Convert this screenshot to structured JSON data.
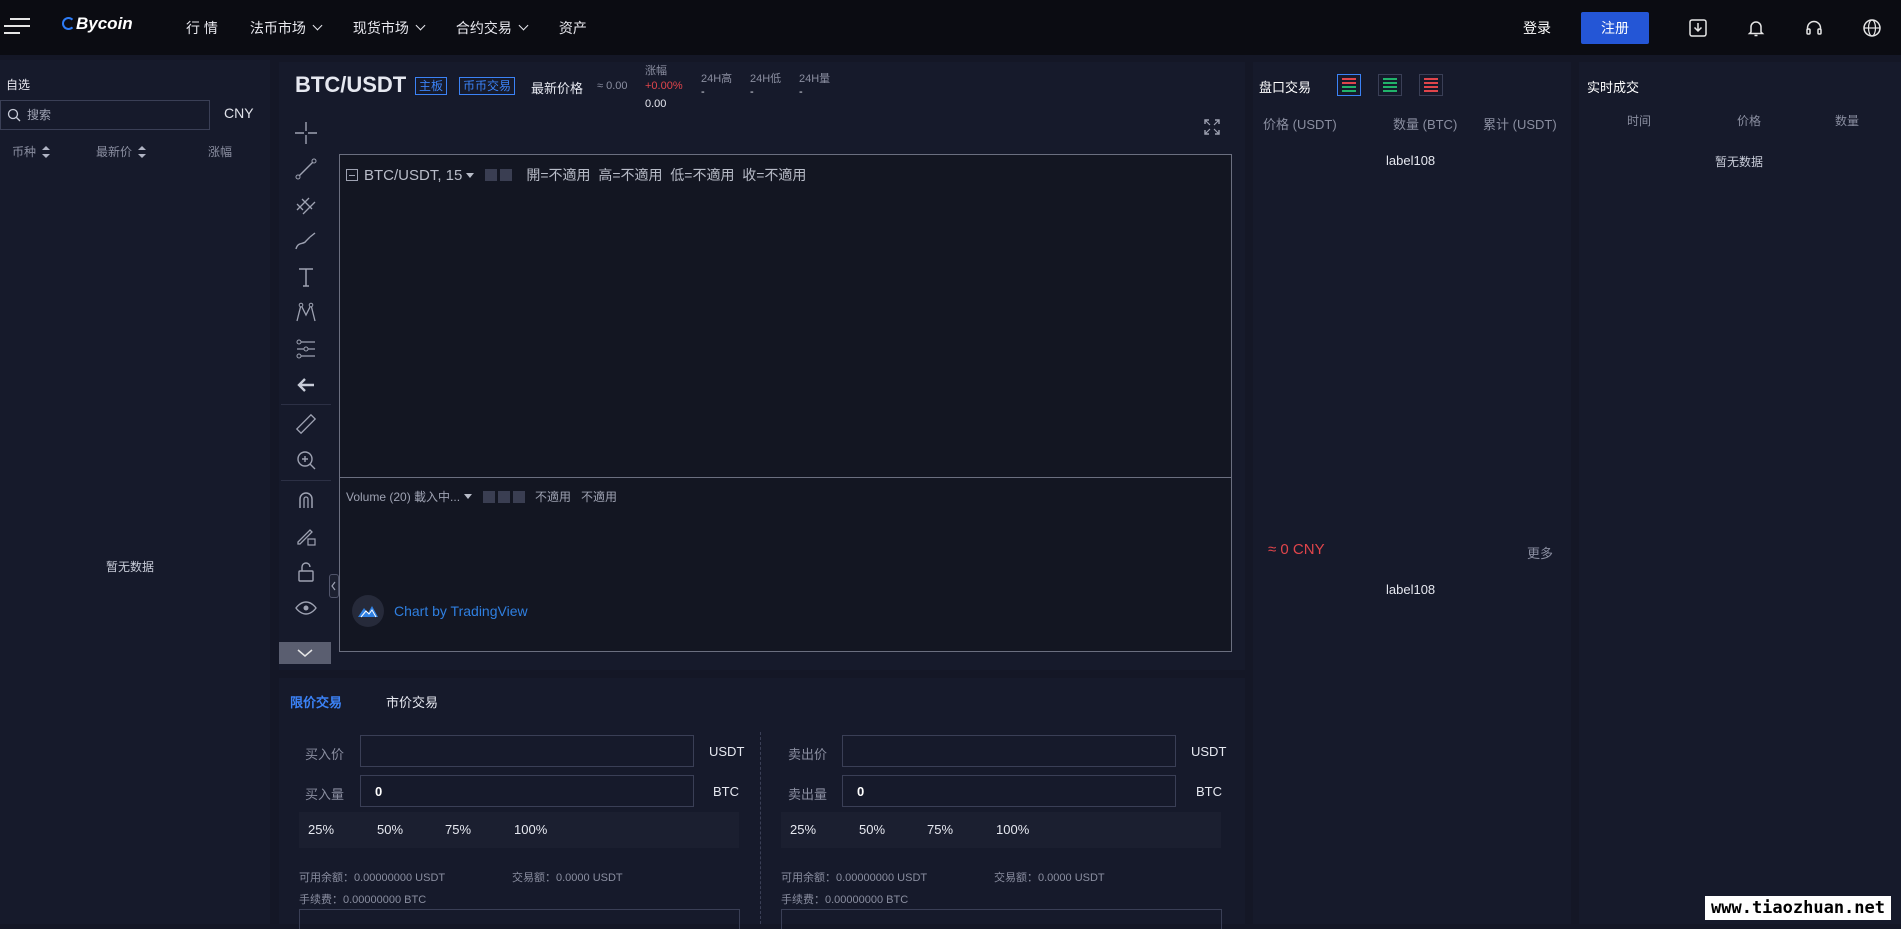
{
  "nav": {
    "logo": "Bycoin",
    "items": [
      {
        "label": "行 情",
        "dropdown": false
      },
      {
        "label": "法币市场",
        "dropdown": true
      },
      {
        "label": "现货市场",
        "dropdown": true
      },
      {
        "label": "合约交易",
        "dropdown": true
      },
      {
        "label": "资产",
        "dropdown": false
      }
    ],
    "login": "登录",
    "register": "注册",
    "icons": [
      "download-icon",
      "bell-icon",
      "headset-icon",
      "globe-icon"
    ]
  },
  "watchlist": {
    "title": "自选",
    "search_placeholder": "搜索",
    "currency": "CNY",
    "columns": [
      "币种",
      "最新价",
      "涨幅"
    ],
    "empty": "暂无数据"
  },
  "ticker": {
    "pair": "BTC/USDT",
    "tag_main": "主板",
    "tag_type": "币币交易",
    "latest_label": "最新价格",
    "latest_approx": "≈ 0.00",
    "change_label": "涨幅",
    "change_pct": "+0.00%",
    "change_val": "0.00",
    "high_label": "24H高",
    "high_val": "-",
    "low_label": "24H低",
    "low_val": "-",
    "vol_label": "24H量",
    "vol_val": "-"
  },
  "chart": {
    "legend_title": "BTC/USDT, 15",
    "ohlc": "開=不適用  高=不適用  低=不適用  收=不適用",
    "volume_title": "Volume (20) 載入中...",
    "volume_vals": "不適用   不適用",
    "attribution": "Chart by TradingView"
  },
  "order": {
    "tab_limit": "限价交易",
    "tab_market": "市价交易",
    "buy": {
      "price_label": "买入价",
      "amount_label": "买入量",
      "price_unit": "USDT",
      "amount_unit": "BTC",
      "amount_value": "0",
      "available": "可用余额：0.00000000 USDT",
      "trade_amount": "交易额：0.0000 USDT",
      "fee": "手续费：0.00000000 BTC"
    },
    "sell": {
      "price_label": "卖出价",
      "amount_label": "卖出量",
      "price_unit": "USDT",
      "amount_unit": "BTC",
      "amount_value": "0",
      "available": "可用余额：0.00000000 USDT",
      "trade_amount": "交易额：0.0000 USDT",
      "fee": "手续费：0.00000000 BTC"
    },
    "percents": [
      "25%",
      "50%",
      "75%",
      "100%"
    ]
  },
  "orderbook": {
    "title": "盘口交易",
    "col_price": "价格 (USDT)",
    "col_amount": "数量 (BTC)",
    "col_total": "累计 (USDT)",
    "asks_label": "label108",
    "mid_price": "≈ 0 CNY",
    "more": "更多",
    "bids_label": "label108"
  },
  "trades": {
    "title": "实时成交",
    "columns": [
      "时间",
      "价格",
      "数量"
    ],
    "empty": "暂无数据"
  },
  "colors": {
    "accent": "#2456d6",
    "up": "#e0454b",
    "down": "#21b36a",
    "link": "#3b82f6"
  },
  "watermark": "www.tiaozhuan.net"
}
